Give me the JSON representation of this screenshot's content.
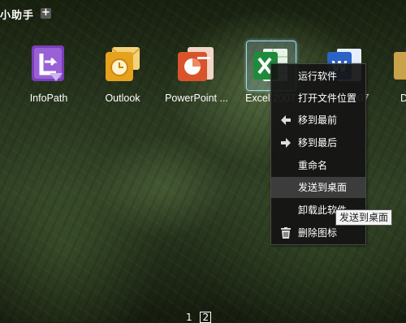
{
  "window": {
    "title": "小助手",
    "add_label": "+"
  },
  "apps": [
    {
      "label": "InfoPath",
      "icon": "infopath-icon",
      "color": "#7a3fb8"
    },
    {
      "label": "Outlook",
      "icon": "outlook-icon",
      "color": "#e6a21c"
    },
    {
      "label": "PowerPoint ...",
      "icon": "powerpoint-icon",
      "color": "#d9532b"
    },
    {
      "label": "Excel 2007",
      "icon": "excel-icon",
      "color": "#1f8a3b"
    },
    {
      "label": "Word 2007",
      "icon": "word-icon",
      "color": "#2a62c6"
    },
    {
      "label": "D",
      "icon": "folder-icon",
      "color": "#c9a24a"
    }
  ],
  "context_menu": {
    "items": [
      {
        "label": "运行软件",
        "icon": ""
      },
      {
        "label": "打开文件位置",
        "icon": ""
      },
      {
        "label": "移到最前",
        "icon": "arrow-left-icon"
      },
      {
        "label": "移到最后",
        "icon": "arrow-right-icon"
      },
      {
        "label": "重命名",
        "icon": ""
      },
      {
        "label": "发送到桌面",
        "icon": "",
        "highlighted": true
      },
      {
        "label": "卸载此软件",
        "icon": ""
      },
      {
        "label": "删除图标",
        "icon": "trash-icon"
      }
    ]
  },
  "tooltip": "发送到桌面",
  "pager": {
    "pages": [
      "1",
      "2"
    ],
    "current": "2"
  }
}
